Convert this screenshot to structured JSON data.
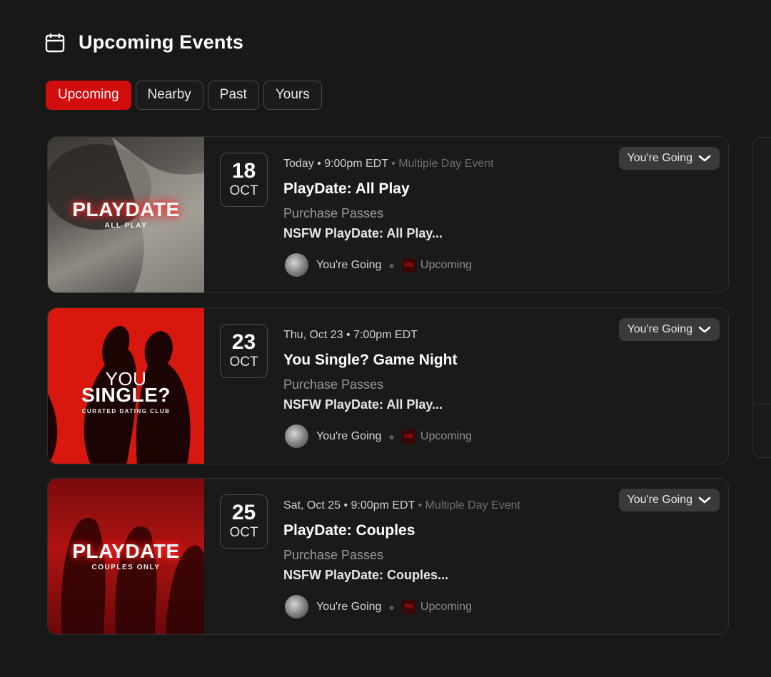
{
  "header": {
    "title": "Upcoming Events",
    "icon": "calendar-icon"
  },
  "tabs": [
    {
      "label": "Upcoming",
      "active": true
    },
    {
      "label": "Nearby",
      "active": false
    },
    {
      "label": "Past",
      "active": false
    },
    {
      "label": "Yours",
      "active": false
    }
  ],
  "colors": {
    "accent": "#d20d0d",
    "background": "#181818",
    "card": "#1a1a1a"
  },
  "events": [
    {
      "thumb_title": "PLAYDATE",
      "thumb_subtitle": "ALL PLAY",
      "day": "18",
      "month": "OCT",
      "when": "Today • 9:00pm EDT",
      "extra": "• Multiple Day Event",
      "title": "PlayDate: All Play",
      "passes": "Purchase Passes",
      "organizer": "NSFW PlayDate: All Play...",
      "going": "You're Going",
      "status": "Upcoming",
      "rsvp": "You're Going"
    },
    {
      "thumb_title_1": "YOU",
      "thumb_title_2": "SINGLE?",
      "thumb_subtitle": "CURATED DATING CLUB",
      "day": "23",
      "month": "OCT",
      "when": "Thu, Oct 23 • 7:00pm EDT",
      "extra": "",
      "title": "You Single? Game Night",
      "passes": "Purchase Passes",
      "organizer": "NSFW PlayDate: All Play...",
      "going": "You're Going",
      "status": "Upcoming",
      "rsvp": "You're Going"
    },
    {
      "thumb_title": "PLAYDATE",
      "thumb_subtitle": "COUPLES ONLY",
      "day": "25",
      "month": "OCT",
      "when": "Sat, Oct 25 • 9:00pm EDT",
      "extra": "• Multiple Day Event",
      "title": "PlayDate: Couples",
      "passes": "Purchase Passes",
      "organizer": "NSFW PlayDate: Couples...",
      "going": "You're Going",
      "status": "Upcoming",
      "rsvp": "You're Going"
    }
  ]
}
